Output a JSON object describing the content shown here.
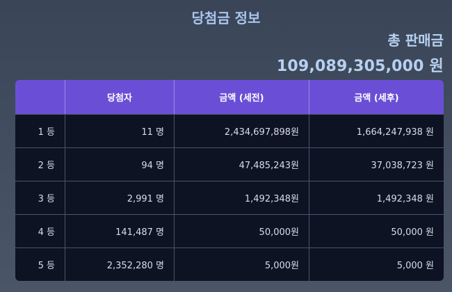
{
  "page_title": "당첨금 정보",
  "total": {
    "label": "총 판매금",
    "value": "109,089,305,000 원"
  },
  "table": {
    "headers": [
      "",
      "당첨자",
      "금액 (세전)",
      "금액 (세후)"
    ],
    "rows": [
      [
        "1 등",
        "11 명",
        "2,434,697,898원",
        "1,664,247,938 원"
      ],
      [
        "2 등",
        "94 명",
        "47,485,243원",
        "37,038,723 원"
      ],
      [
        "3 등",
        "2,991 명",
        "1,492,348원",
        "1,492,348 원"
      ],
      [
        "4 등",
        "141,487 명",
        "50,000원",
        "50,000 원"
      ],
      [
        "5 등",
        "2,352,280 명",
        "5,000원",
        "5,000 원"
      ]
    ]
  },
  "colors": {
    "header_bg": "#6a4fd6",
    "row_bg": "#0d1322",
    "accent_text": "#a9c4ec"
  }
}
